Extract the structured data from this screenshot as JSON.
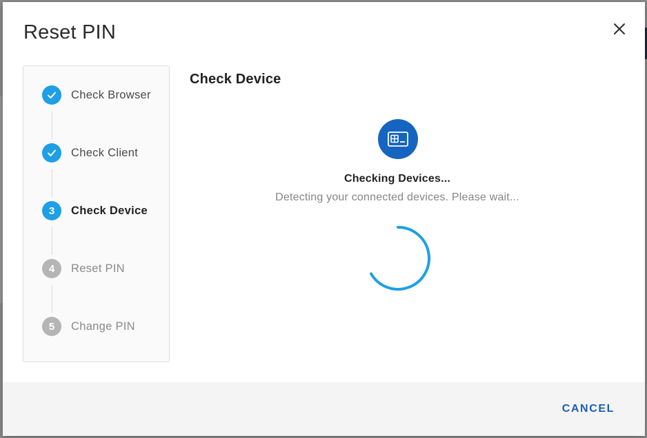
{
  "dialog": {
    "title": "Reset PIN",
    "close_icon": "close-icon"
  },
  "stepper": {
    "steps": [
      {
        "marker": "",
        "label": "Check Browser",
        "state": "completed",
        "icon": "check-icon"
      },
      {
        "marker": "",
        "label": "Check Client",
        "state": "completed",
        "icon": "check-icon"
      },
      {
        "marker": "3",
        "label": "Check Device",
        "state": "active"
      },
      {
        "marker": "4",
        "label": "Reset PIN",
        "state": "pending"
      },
      {
        "marker": "5",
        "label": "Change PIN",
        "state": "pending"
      }
    ]
  },
  "main": {
    "title": "Check Device",
    "device_icon": "smart-card-reader-icon",
    "status_title": "Checking Devices...",
    "status_description": "Detecting your connected devices. Please wait...",
    "spinner_icon": "loading-spinner-icon"
  },
  "footer": {
    "cancel_label": "CANCEL"
  },
  "colors": {
    "accent": "#1e9fe6",
    "device_badge": "#1565c0",
    "cancel_text": "#1a5fb4",
    "pending_step": "#b5b5b5"
  }
}
